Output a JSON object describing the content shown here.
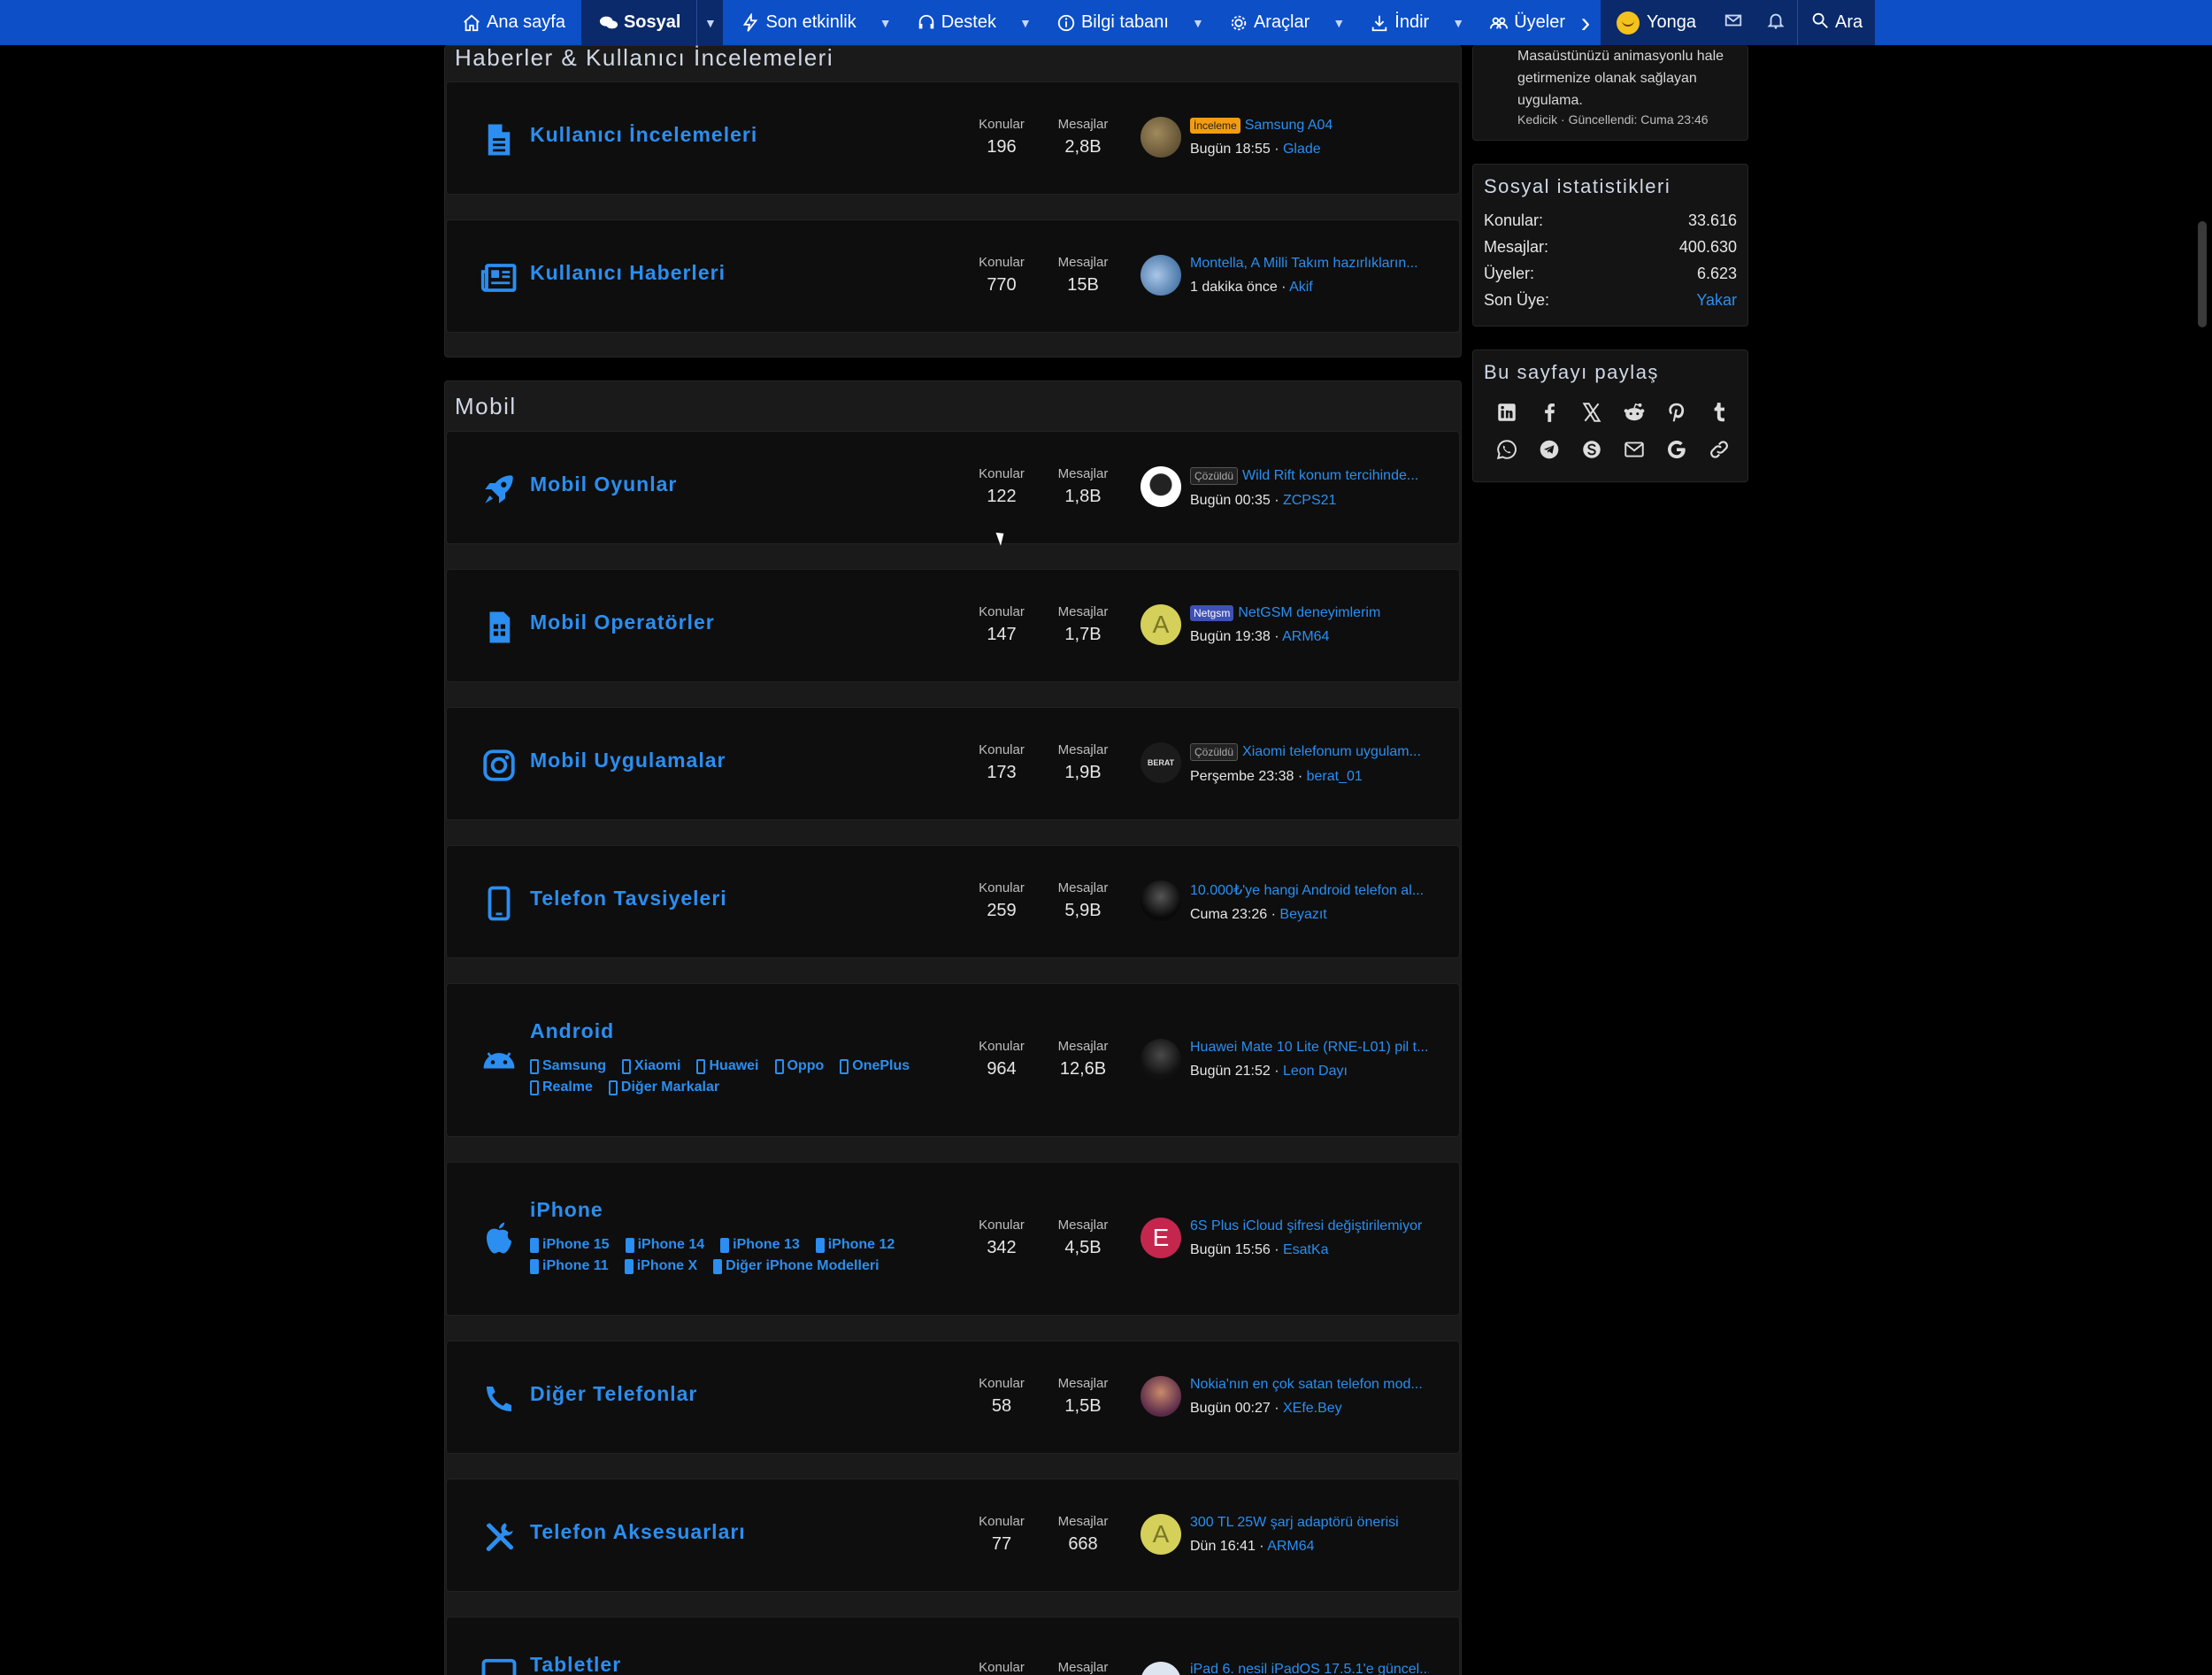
{
  "nav": {
    "items": [
      {
        "label": "Ana sayfa",
        "icon": "home-icon"
      },
      {
        "label": "Sosyal",
        "icon": "comments-icon",
        "active": true
      },
      {
        "label": "Son etkinlik",
        "icon": "bolt-icon"
      },
      {
        "label": "Destek",
        "icon": "headset-icon"
      },
      {
        "label": "Bilgi tabanı",
        "icon": "info-icon"
      },
      {
        "label": "Araçlar",
        "icon": "gear-icon"
      },
      {
        "label": "İndir",
        "icon": "download-icon"
      },
      {
        "label": "Üyeler",
        "icon": "users-icon"
      }
    ],
    "user": "Yonga",
    "search": "Ara"
  },
  "sections": {
    "news_title": "Haberler & Kullanıcı İncelemeleri",
    "mobile_title": "Mobil"
  },
  "stat_labels": {
    "threads": "Konular",
    "messages": "Mesajlar"
  },
  "nodes": [
    {
      "title": "Kullanıcı İncelemeleri",
      "threads": "196",
      "messages": "2,8B",
      "prefix": "İnceleme",
      "latest_title": "Samsung A04",
      "latest_time": "Bugün 18:55",
      "latest_user": "Glade"
    },
    {
      "title": "Kullanıcı Haberleri",
      "threads": "770",
      "messages": "15B",
      "prefix": "",
      "latest_title": "Montella, A Milli Takım hazırlıkların...",
      "latest_time": "1 dakika önce",
      "latest_user": "Akif"
    },
    {
      "title": "Mobil Oyunlar",
      "threads": "122",
      "messages": "1,8B",
      "prefix": "Çözüldü",
      "latest_title": "Wild Rift konum tercihinde...",
      "latest_time": "Bugün 00:35",
      "latest_user": "ZCPS21"
    },
    {
      "title": "Mobil Operatörler",
      "threads": "147",
      "messages": "1,7B",
      "prefix": "Netgsm",
      "latest_title": "NetGSM deneyimlerim",
      "latest_time": "Bugün 19:38",
      "latest_user": "ARM64",
      "avatar_letter": "A"
    },
    {
      "title": "Mobil Uygulamalar",
      "threads": "173",
      "messages": "1,9B",
      "prefix": "Çözüldü",
      "latest_title": "Xiaomi telefonum uygulam...",
      "latest_time": "Perşembe 23:38",
      "latest_user": "berat_01",
      "avatar_text": "BERAT"
    },
    {
      "title": "Telefon Tavsiyeleri",
      "threads": "259",
      "messages": "5,9B",
      "prefix": "",
      "latest_title": "10.000₺'ye hangi Android telefon al...",
      "latest_time": "Cuma 23:26",
      "latest_user": "Beyazıt"
    },
    {
      "title": "Android",
      "threads": "964",
      "messages": "12,6B",
      "prefix": "",
      "latest_title": "Huawei Mate 10 Lite (RNE-L01) pil t...",
      "latest_time": "Bugün 21:52",
      "latest_user": "Leon Dayı",
      "subforums": [
        "Samsung",
        "Xiaomi",
        "Huawei",
        "Oppo",
        "OnePlus",
        "Realme",
        "Diğer Markalar"
      ]
    },
    {
      "title": "iPhone",
      "threads": "342",
      "messages": "4,5B",
      "prefix": "",
      "latest_title": "6S Plus iCloud şifresi değiştirilemiyor",
      "latest_time": "Bugün 15:56",
      "latest_user": "EsatKa",
      "avatar_letter": "E",
      "subforums": [
        "iPhone 15",
        "iPhone 14",
        "iPhone 13",
        "iPhone 12",
        "iPhone 11",
        "iPhone X",
        "Diğer iPhone Modelleri"
      ]
    },
    {
      "title": "Diğer Telefonlar",
      "threads": "58",
      "messages": "1,5B",
      "prefix": "",
      "latest_title": "Nokia'nın en çok satan telefon mod...",
      "latest_time": "Bugün 00:27",
      "latest_user": "XEfe.Bey"
    },
    {
      "title": "Telefon Aksesuarları",
      "threads": "77",
      "messages": "668",
      "prefix": "",
      "latest_title": "300 TL 25W şarj adaptörü önerisi",
      "latest_time": "Dün 16:41",
      "latest_user": "ARM64",
      "avatar_letter": "A"
    },
    {
      "title": "Tabletler",
      "threads": "",
      "messages": "",
      "prefix": "",
      "latest_title": "iPad 6. nesil iPadOS 17.5.1'e güncel...",
      "latest_time": "",
      "latest_user": ""
    }
  ],
  "sidebar": {
    "app_desc": "Masaüstünüzü animasyonlu hale getirmenize olanak sağlayan uygulama.",
    "app_meta": "Kedicik · Güncellendi: Cuma 23:46",
    "stats_title": "Sosyal istatistikleri",
    "stats": [
      {
        "label": "Konular:",
        "value": "33.616"
      },
      {
        "label": "Mesajlar:",
        "value": "400.630"
      },
      {
        "label": "Üyeler:",
        "value": "6.623"
      },
      {
        "label": "Son Üye:",
        "value": "Yakar"
      }
    ],
    "share_title": "Bu sayfayı paylaş",
    "share_icons": [
      "linkedin-icon",
      "facebook-icon",
      "x-icon",
      "reddit-icon",
      "pinterest-icon",
      "tumblr-icon",
      "whatsapp-icon",
      "telegram-icon",
      "skype-icon",
      "email-icon",
      "google-icon",
      "link-icon"
    ]
  },
  "colors": {
    "nav": "#0c4fc7",
    "accent": "#2b8ef0",
    "background": "#000000"
  }
}
